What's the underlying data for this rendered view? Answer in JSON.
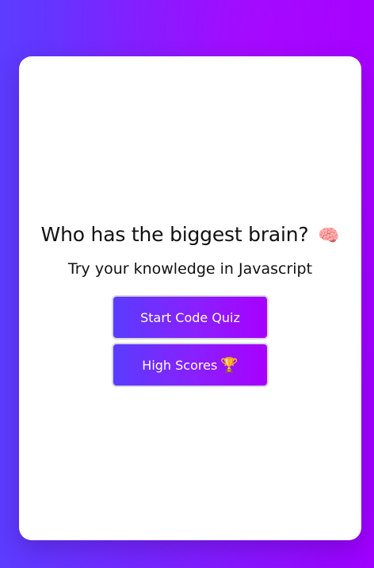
{
  "page": {
    "title": "Who has the biggest brain?",
    "title_emoji": "🧠",
    "subtitle": "Try your knowledge in Javascript"
  },
  "buttons": {
    "start_label": "Start Code Quiz",
    "high_scores_label": "High Scores",
    "high_scores_emoji": "🏆"
  },
  "icons": {
    "title_icon": "brain-icon",
    "high_scores_icon": "trophy-icon"
  },
  "colors": {
    "background_gradient_start": "#5c3cff",
    "background_gradient_end": "#a000ff",
    "button_gradient_start": "#5a3cff",
    "button_gradient_end": "#a800ff",
    "card": "#ffffff"
  }
}
